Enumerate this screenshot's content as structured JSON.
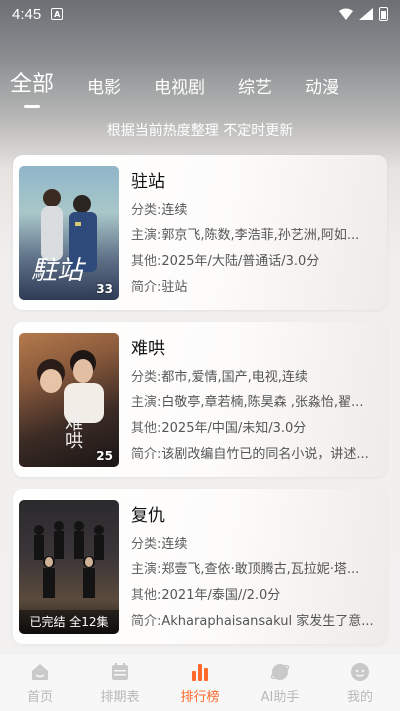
{
  "status": {
    "time": "4:45",
    "app_badge": "A"
  },
  "tabs": [
    {
      "label": "全部",
      "active": true
    },
    {
      "label": "电影",
      "active": false
    },
    {
      "label": "电视剧",
      "active": false
    },
    {
      "label": "综艺",
      "active": false
    },
    {
      "label": "动漫",
      "active": false
    }
  ],
  "subtitle": "根据当前热度整理 不定时更新",
  "labels": {
    "category": "分类:",
    "cast": "主演:",
    "other": "其他:",
    "intro": "简介:"
  },
  "items": [
    {
      "title": "驻站",
      "category": "连续",
      "cast": "郭京飞,陈数,李浩菲,孙艺洲,阿如...",
      "other": "2025年/大陆/普通话/3.0分",
      "intro": "驻站",
      "poster_badge": "33",
      "poster_text": "駐站"
    },
    {
      "title": "难哄",
      "category": "都市,爱情,国产,电视,连续",
      "cast": "白敬亭,章若楠,陈昊森 ,张淼怡,翟...",
      "other": "2025年/中国/未知/3.0分",
      "intro": "该剧改编自竹已的同名小说，讲述...",
      "poster_badge": "25",
      "poster_text": "难哄"
    },
    {
      "title": "复仇",
      "category": "连续",
      "cast": "郑壹飞,查依·敢顶腾古,瓦拉妮·塔...",
      "other": "2021年/泰国//2.0分",
      "intro": "Akharaphaisansakul 家发生了意...",
      "poster_badge": "已完结 全12集",
      "poster_text": ""
    }
  ],
  "nav": [
    {
      "label": "首页",
      "icon": "home-icon",
      "active": false
    },
    {
      "label": "排期表",
      "icon": "calendar-icon",
      "active": false
    },
    {
      "label": "排行榜",
      "icon": "ranking-icon",
      "active": true
    },
    {
      "label": "AI助手",
      "icon": "ai-assistant-icon",
      "active": false
    },
    {
      "label": "我的",
      "icon": "profile-icon",
      "active": false
    }
  ],
  "colors": {
    "accent": "#ff6a2c",
    "nav_inactive": "#b8b8b8"
  }
}
